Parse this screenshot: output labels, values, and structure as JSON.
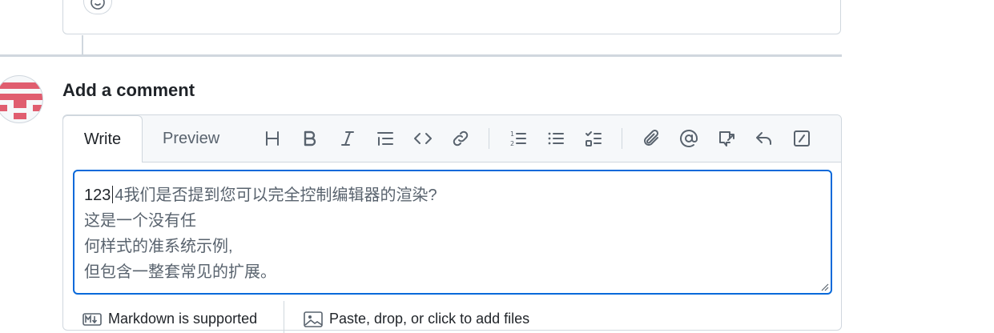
{
  "comment_form": {
    "heading": "Add a comment",
    "tabs": {
      "write": "Write",
      "preview": "Preview"
    },
    "toolbar_icons": [
      "heading-icon",
      "bold-icon",
      "italic-icon",
      "quote-icon",
      "code-icon",
      "link-icon",
      "ordered-list-icon",
      "unordered-list-icon",
      "task-list-icon",
      "attach-icon",
      "mention-icon",
      "cross-reference-icon",
      "reply-icon",
      "slash-commands-icon"
    ],
    "text": {
      "line1_typed": "123",
      "line1_rest": "4我们是否提到您可以完全控制编辑器的渲染?",
      "line2": "这是一个没有任",
      "line3": "何样式的准系统示例,",
      "line4": "但包含一整套常见的扩展。"
    },
    "footer": {
      "markdown": "Markdown is supported",
      "files": "Paste, drop, or click to add files"
    }
  },
  "colors": {
    "accent": "#0969da",
    "border": "#d0d7de",
    "muted": "#59636e",
    "avatar": "#e05d6f"
  }
}
